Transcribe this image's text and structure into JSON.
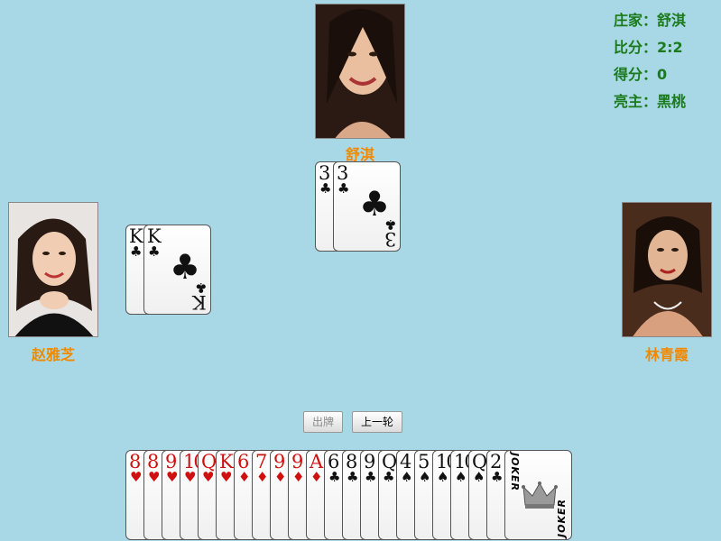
{
  "info": {
    "dealer_label": "庄家：",
    "dealer_value": "舒淇",
    "ratio_label": "比分：",
    "ratio_value": "2:2",
    "score_label": "得分：",
    "score_value": "0",
    "trump_label": "亮主：",
    "trump_value": "黑桃"
  },
  "players": {
    "top": {
      "name": "舒淇"
    },
    "left": {
      "name": "赵雅芝"
    },
    "right": {
      "name": "林青霞"
    }
  },
  "buttons": {
    "play": "出牌",
    "last_round": "上一轮"
  },
  "trick": {
    "top": [
      {
        "rank": "3",
        "suit": "♣",
        "color": "black"
      },
      {
        "rank": "3",
        "suit": "♣",
        "color": "black"
      }
    ],
    "left": [
      {
        "rank": "K",
        "suit": "♣",
        "color": "black"
      },
      {
        "rank": "K",
        "suit": "♣",
        "color": "black"
      }
    ]
  },
  "hand": [
    {
      "rank": "8",
      "suit": "♥",
      "color": "red"
    },
    {
      "rank": "8",
      "suit": "♥",
      "color": "red"
    },
    {
      "rank": "9",
      "suit": "♥",
      "color": "red"
    },
    {
      "rank": "10",
      "suit": "♥",
      "color": "red"
    },
    {
      "rank": "Q",
      "suit": "♥",
      "color": "red"
    },
    {
      "rank": "K",
      "suit": "♥",
      "color": "red"
    },
    {
      "rank": "6",
      "suit": "♦",
      "color": "red"
    },
    {
      "rank": "7",
      "suit": "♦",
      "color": "red"
    },
    {
      "rank": "9",
      "suit": "♦",
      "color": "red"
    },
    {
      "rank": "9",
      "suit": "♦",
      "color": "red"
    },
    {
      "rank": "A",
      "suit": "♦",
      "color": "red"
    },
    {
      "rank": "6",
      "suit": "♣",
      "color": "black"
    },
    {
      "rank": "8",
      "suit": "♣",
      "color": "black"
    },
    {
      "rank": "9",
      "suit": "♣",
      "color": "black"
    },
    {
      "rank": "Q",
      "suit": "♣",
      "color": "black"
    },
    {
      "rank": "4",
      "suit": "♠",
      "color": "black"
    },
    {
      "rank": "5",
      "suit": "♠",
      "color": "black"
    },
    {
      "rank": "10",
      "suit": "♠",
      "color": "black"
    },
    {
      "rank": "10",
      "suit": "♠",
      "color": "black"
    },
    {
      "rank": "Q",
      "suit": "♠",
      "color": "black"
    },
    {
      "rank": "2",
      "suit": "♣",
      "color": "black"
    },
    {
      "rank": "JOKER",
      "suit": "",
      "color": "black"
    }
  ]
}
